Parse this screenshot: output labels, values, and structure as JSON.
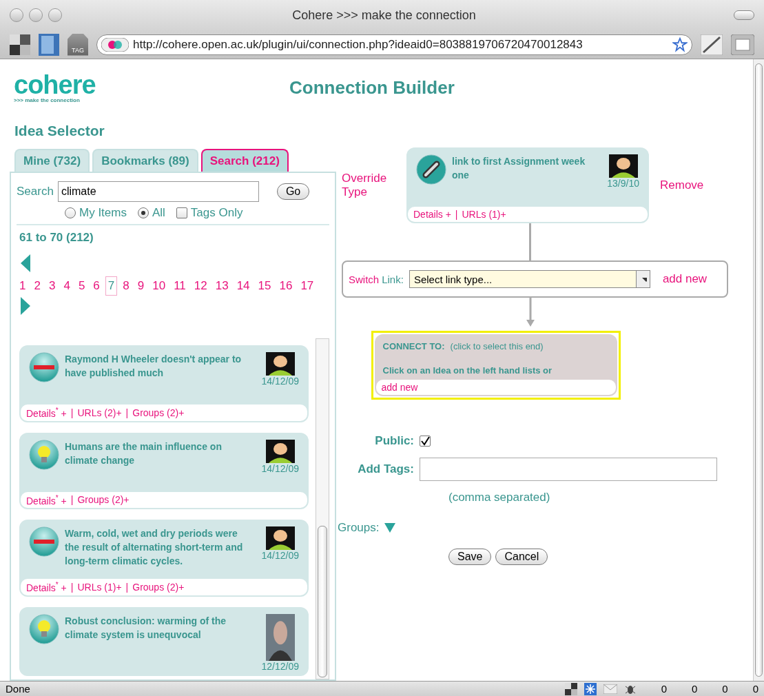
{
  "window": {
    "title": "Cohere >>> make the connection"
  },
  "toolbar": {
    "url": "http://cohere.open.ac.uk/plugin/ui/connection.php?ideaid0=8038819706720470012843",
    "tag_label": "TAG"
  },
  "header": {
    "logo": "cohere",
    "tagline": ">>> make the connection",
    "page_title": "Connection Builder"
  },
  "idea_selector": {
    "title": "Idea Selector",
    "tabs": [
      {
        "label": "Mine (732)",
        "selected": false
      },
      {
        "label": "Bookmarks (89)",
        "selected": false
      },
      {
        "label": "Search (212)",
        "selected": true
      }
    ],
    "search": {
      "label": "Search",
      "value": "climate",
      "button": "Go"
    },
    "filters": [
      {
        "kind": "radio",
        "label": "My Items",
        "checked": false
      },
      {
        "kind": "radio",
        "label": "All",
        "checked": true
      },
      {
        "kind": "checkbox",
        "label": "Tags Only",
        "checked": false
      }
    ],
    "range": "61 to 70 (212)",
    "pages": [
      {
        "label": "1",
        "selected": false
      },
      {
        "label": "2",
        "selected": false
      },
      {
        "label": "3",
        "selected": false
      },
      {
        "label": "4",
        "selected": false
      },
      {
        "label": "5",
        "selected": false
      },
      {
        "label": "6",
        "selected": false
      },
      {
        "label": "7",
        "selected": true
      },
      {
        "label": "8",
        "selected": false
      },
      {
        "label": "9",
        "selected": false
      },
      {
        "label": "10",
        "selected": false
      },
      {
        "label": "11",
        "selected": false
      },
      {
        "label": "12",
        "selected": false
      },
      {
        "label": "13",
        "selected": false
      },
      {
        "label": "14",
        "selected": false
      },
      {
        "label": "15",
        "selected": false
      },
      {
        "label": "16",
        "selected": false
      },
      {
        "label": "17",
        "selected": false
      }
    ],
    "link_separator": "|",
    "ideas": [
      {
        "kind": "con",
        "title": "Raymond H Wheeler doesn't appear to have published much",
        "date": "14/12/09",
        "links": [
          "Details$^{*}$ +",
          "URLs (2)+",
          "Groups (2)+"
        ]
      },
      {
        "kind": "pro",
        "title": "Humans are the main influence on climate change",
        "date": "14/12/09",
        "links": [
          "Details$^{*}$ +",
          "Groups (2)+"
        ]
      },
      {
        "kind": "con",
        "title": "Warm, cold, wet and dry periods were the result of alternating short-term and long-term climatic cycles.",
        "date": "14/12/09",
        "links": [
          "Details$^{*}$ +",
          "URLs (1)+",
          "Groups (2)+"
        ]
      },
      {
        "kind": "pro",
        "title": "Robust conclusion: warming of the climate system is unequvocal",
        "date": "12/12/09"
      }
    ]
  },
  "builder": {
    "override": "Override Type",
    "remove": "Remove",
    "from_node": {
      "title": "link to first Assignment week one",
      "date": "13/9/10",
      "links": [
        "Details +",
        "URLs (1)+"
      ]
    },
    "switch_label": "Switch",
    "link_label": "Link:",
    "link_select": "Select link type...",
    "add_link": "add new",
    "connect": {
      "heading": "CONNECT TO:",
      "hint": "(click to select this end)",
      "instruction": "Click on an Idea on the left hand lists or",
      "add": "add new"
    },
    "public_label": "Public:",
    "public": {
      "checked": true
    },
    "tags_label": "Add Tags:",
    "tags_hint": "(comma separated)",
    "groups_label": "Groups:",
    "buttons": [
      "Save",
      "Cancel"
    ]
  },
  "status_bar": {
    "text": "Done",
    "counters": [
      "0",
      "0",
      "0",
      "0"
    ]
  }
}
